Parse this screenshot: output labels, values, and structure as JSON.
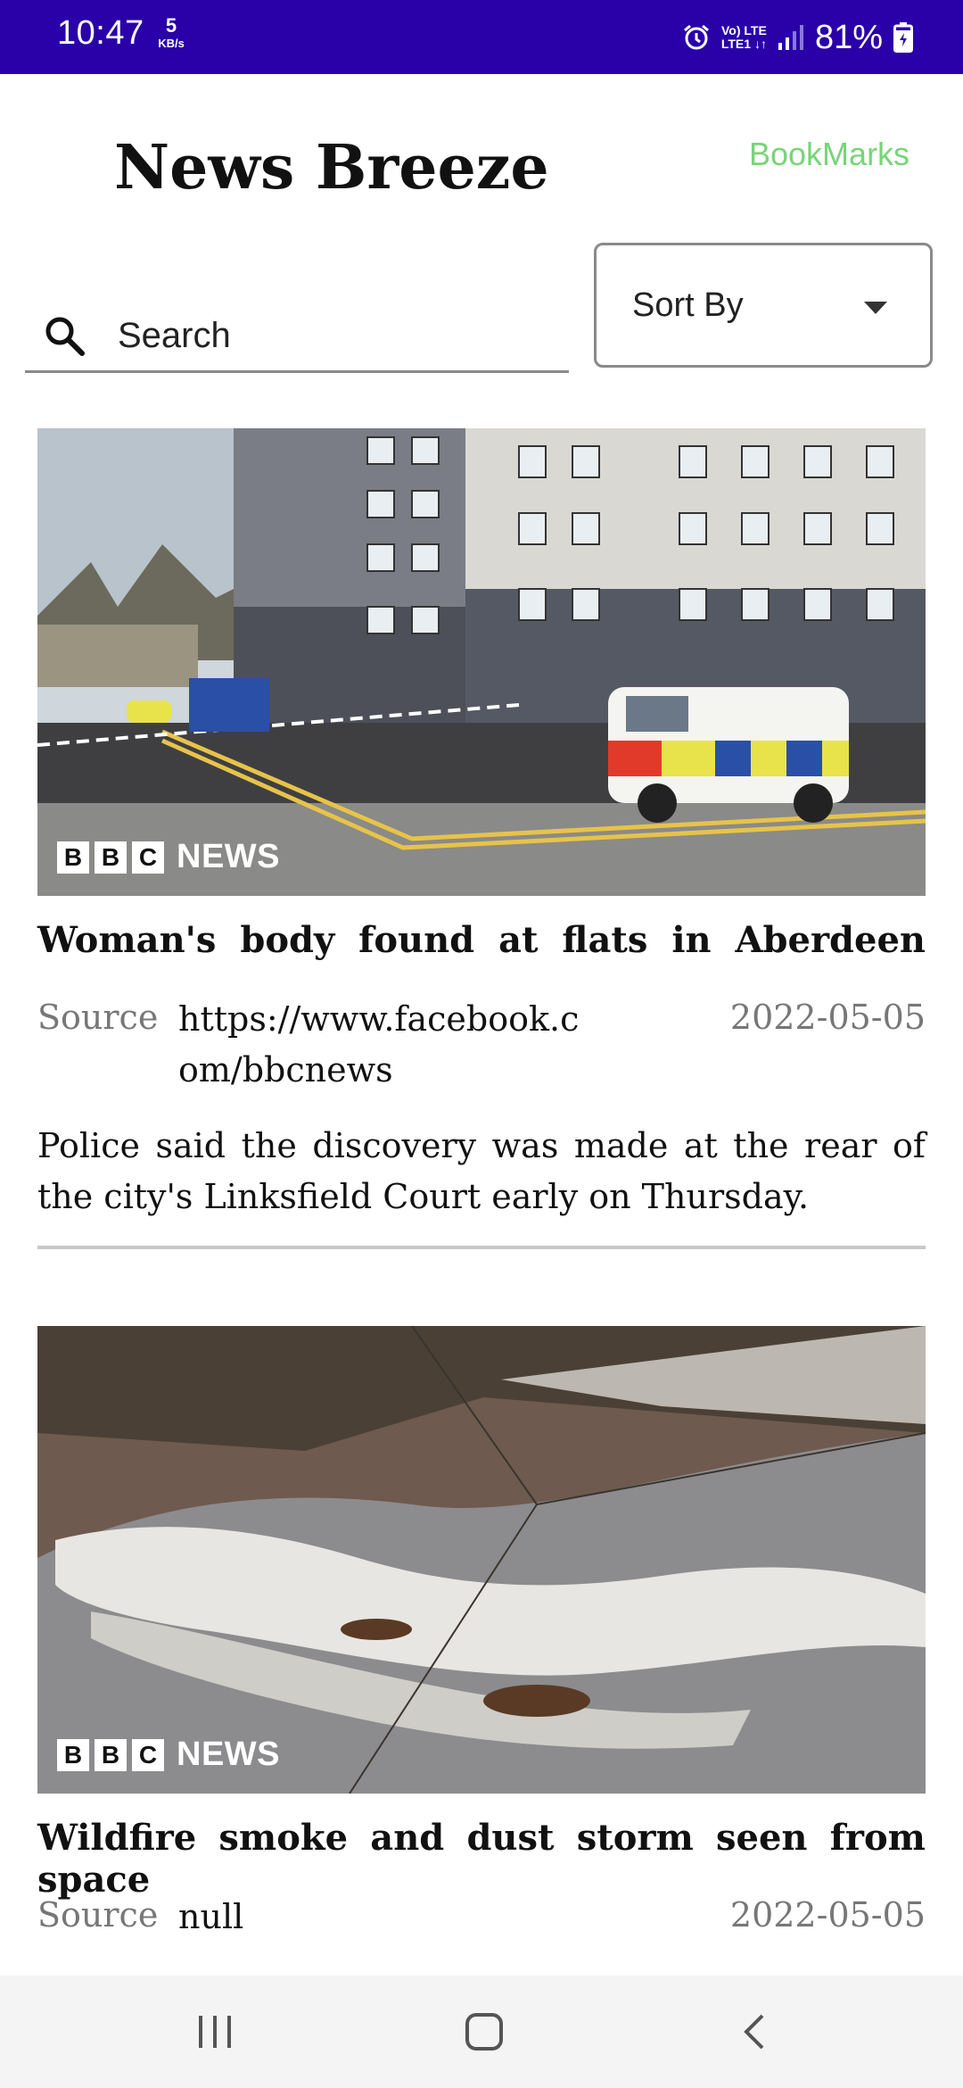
{
  "status_bar": {
    "time": "10:47",
    "net_speed_value": "5",
    "net_speed_unit": "KB/s",
    "network_line1": "Vo) LTE",
    "network_line2": "LTE1 ↓↑",
    "battery": "81%"
  },
  "header": {
    "app_title": "News Breeze",
    "bookmarks_label": "BookMarks"
  },
  "search": {
    "placeholder": "Search",
    "value": ""
  },
  "sort": {
    "label": "Sort By"
  },
  "articles": [
    {
      "image_icon": "police-scene-photo",
      "logo_text": "NEWS",
      "title": "Woman's body found at flats in Aberdeen",
      "source_label": "Source",
      "source": "https://www.facebook.com/bbcnews",
      "date": "2022-05-05",
      "description": "Police said the discovery was made at the rear of the city's Linksfield Court early on Thursday."
    },
    {
      "image_icon": "wildfire-satellite-photo",
      "logo_text": "NEWS",
      "title": "Wildfire smoke and dust storm seen from space",
      "source_label": "Source",
      "source": "null",
      "date": "2022-05-05"
    }
  ],
  "bbc_letters": [
    "B",
    "B",
    "C"
  ],
  "colors": {
    "status_bar": "#2a00a8",
    "bookmarks": "#78d478",
    "divider": "#c8c8c8"
  }
}
